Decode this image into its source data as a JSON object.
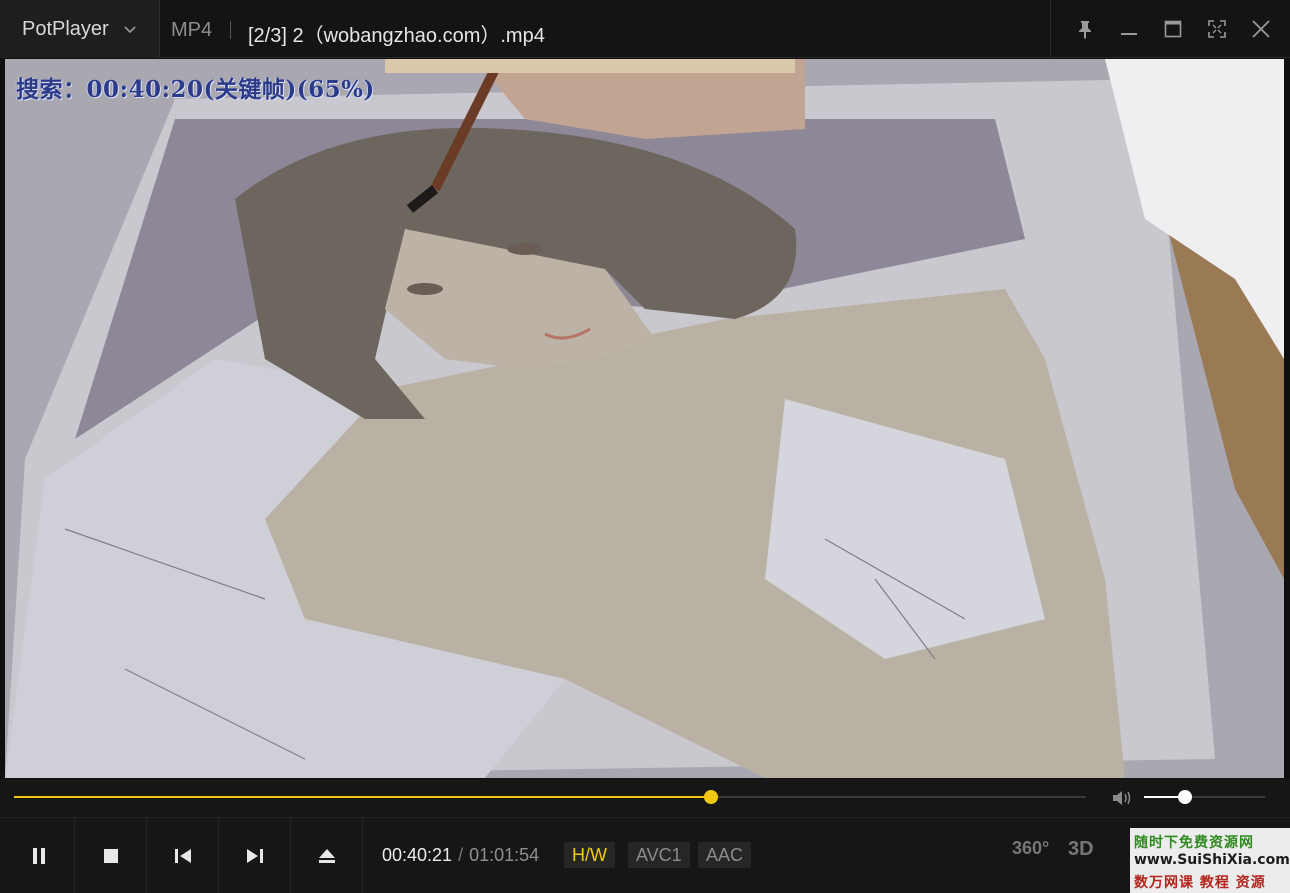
{
  "app": {
    "name": "PotPlayer"
  },
  "titlebar": {
    "format": "MP4",
    "file_title": "[2/3] 2（wobangzhao.com）.mp4"
  },
  "window_controls": [
    "pin-icon",
    "minimize-icon",
    "maximize-icon",
    "fullscreen-icon",
    "close-icon"
  ],
  "osd": {
    "text": "搜索：00:40:20(关键帧)(65%)"
  },
  "seek": {
    "progress": 0.65
  },
  "volume": {
    "level": 0.34
  },
  "playback": {
    "buttons": [
      "pause-icon",
      "stop-icon",
      "previous-icon",
      "next-icon",
      "eject-icon"
    ],
    "current_time": "00:40:21",
    "separator": "/",
    "duration": "01:01:54"
  },
  "badges": {
    "hw": "H/W",
    "video_codec": "AVC1",
    "audio_codec": "AAC"
  },
  "right_controls": {
    "vr": "360°",
    "stereo": "3D"
  },
  "watermark": {
    "line1": "随时下免费资源网",
    "line2": "www.SuiShiXia.com",
    "line3": "数万网课 教程 资源"
  },
  "colors": {
    "accent": "#f0c814",
    "osd_text": "#2c3a8a",
    "background": "#161616"
  }
}
